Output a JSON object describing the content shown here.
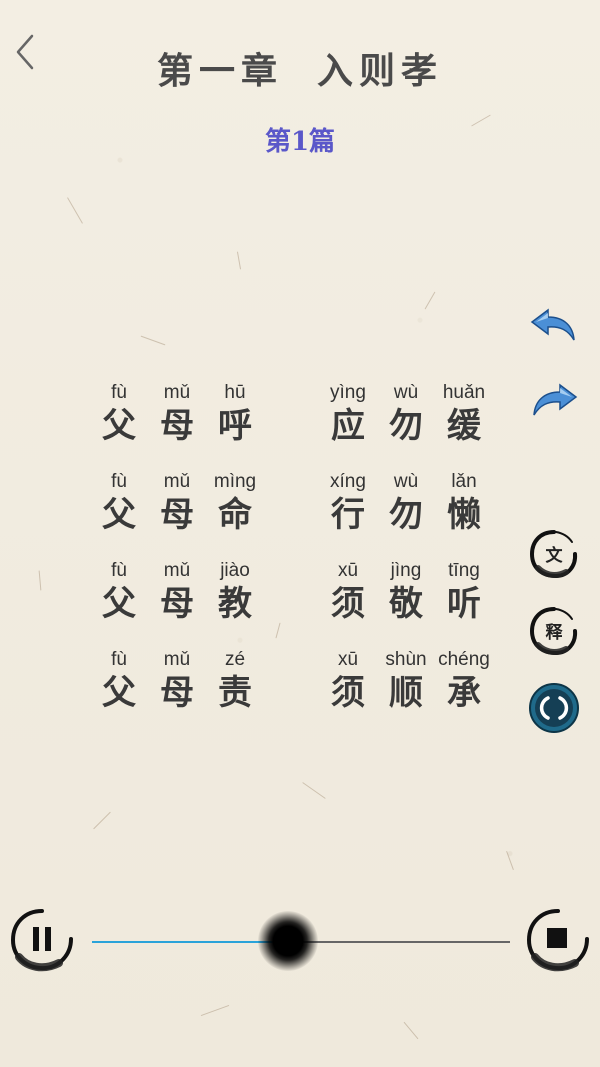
{
  "header": {
    "chapter": "第一章",
    "chapter_title": "入则孝",
    "section": "第1篇"
  },
  "verses": [
    [
      [
        {
          "py": "fù",
          "hz": "父"
        },
        {
          "py": "mǔ",
          "hz": "母"
        },
        {
          "py": "hū",
          "hz": "呼"
        }
      ],
      [
        {
          "py": "yìng",
          "hz": "应"
        },
        {
          "py": "wù",
          "hz": "勿"
        },
        {
          "py": "huǎn",
          "hz": "缓"
        }
      ]
    ],
    [
      [
        {
          "py": "fù",
          "hz": "父"
        },
        {
          "py": "mǔ",
          "hz": "母"
        },
        {
          "py": "mìng",
          "hz": "命"
        }
      ],
      [
        {
          "py": "xíng",
          "hz": "行"
        },
        {
          "py": "wù",
          "hz": "勿"
        },
        {
          "py": "lǎn",
          "hz": "懒"
        }
      ]
    ],
    [
      [
        {
          "py": "fù",
          "hz": "父"
        },
        {
          "py": "mǔ",
          "hz": "母"
        },
        {
          "py": "jiào",
          "hz": "教"
        }
      ],
      [
        {
          "py": "xū",
          "hz": "须"
        },
        {
          "py": "jìng",
          "hz": "敬"
        },
        {
          "py": "tīng",
          "hz": "听"
        }
      ]
    ],
    [
      [
        {
          "py": "fù",
          "hz": "父"
        },
        {
          "py": "mǔ",
          "hz": "母"
        },
        {
          "py": "zé",
          "hz": "责"
        }
      ],
      [
        {
          "py": "xū",
          "hz": "须"
        },
        {
          "py": "shùn",
          "hz": "顺"
        },
        {
          "py": "chéng",
          "hz": "承"
        }
      ]
    ]
  ],
  "side_buttons": {
    "wen_label": "文",
    "shi_label": "释"
  },
  "player": {
    "progress": 0.47
  },
  "icons": {
    "back": "chevron-left-icon",
    "undo": "undo-arrow-icon",
    "redo": "redo-arrow-icon",
    "loop": "loop-icon",
    "pause": "pause-icon",
    "stop": "stop-icon"
  },
  "colors": {
    "section": "#5a57c9",
    "arrow": "#4b8fd6",
    "progress": "#2aa3d9",
    "loop": "#1f6a8a"
  }
}
